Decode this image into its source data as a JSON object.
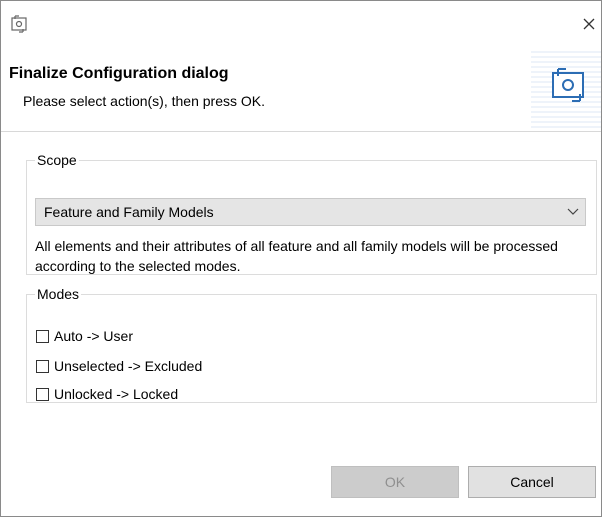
{
  "header": {
    "title": "Finalize Configuration dialog",
    "description": "Please select action(s), then press OK."
  },
  "scope": {
    "legend": "Scope",
    "selected": "Feature and Family Models",
    "description": "All elements and their attributes of all feature and all family models will be processed according to the selected modes."
  },
  "modes": {
    "legend": "Modes",
    "items": [
      {
        "label": "Auto -> User",
        "checked": false
      },
      {
        "label": "Unselected -> Excluded",
        "checked": false
      },
      {
        "label": "Unlocked -> Locked",
        "checked": false
      }
    ]
  },
  "buttons": {
    "ok_label": "OK",
    "cancel_label": "Cancel",
    "ok_enabled": false
  },
  "icons": {
    "title": "finalize-config-icon",
    "close": "close-icon",
    "header": "finalize-config-large-icon",
    "dropdown": "chevron-down-icon"
  },
  "colors": {
    "accent": "#2c6db4",
    "disabled_button": "#cccccc"
  }
}
